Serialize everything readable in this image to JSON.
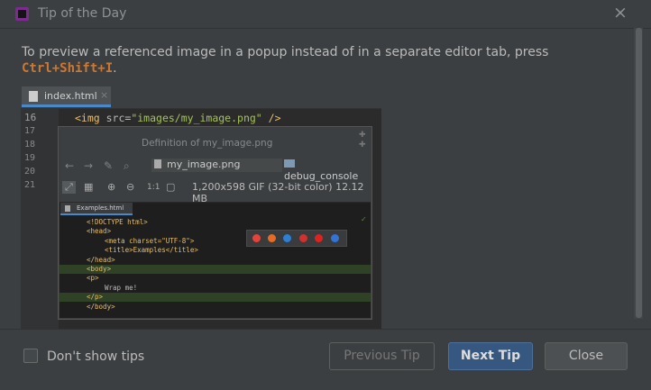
{
  "window": {
    "title": "Tip of the Day"
  },
  "tip": {
    "text": "To preview a referenced image in a popup instead of in a separate editor tab, press",
    "shortcut": "Ctrl+Shift+I",
    "trailing": "."
  },
  "editor": {
    "tab_label": "index.html",
    "line_numbers": [
      "16",
      "17",
      "18",
      "19",
      "20",
      "21"
    ],
    "code_open": "<img ",
    "code_attr": "src=",
    "code_value": "\"images/my_image.png\"",
    "code_close": " />"
  },
  "popup": {
    "title": "Definition of my_image.png",
    "file_name": "my_image.png",
    "folder_name": "debug_console",
    "zoom_actual": "1:1",
    "image_info": "1,200x598 GIF (32-bit color) 12.12 MB"
  },
  "preview": {
    "tab_label": "Examples.html",
    "lines": [
      {
        "text": "<!DOCTYPE html>",
        "indent": 0,
        "hl": false
      },
      {
        "text": "<head>",
        "indent": 0,
        "hl": false
      },
      {
        "text": "<meta charset=\"UTF-8\">",
        "indent": 2,
        "hl": false
      },
      {
        "text": "<title>Examples</title>",
        "indent": 2,
        "hl": false
      },
      {
        "text": "</head>",
        "indent": 0,
        "hl": false
      },
      {
        "text": "<body>",
        "indent": 0,
        "hl": true
      },
      {
        "text": "<p>",
        "indent": 0,
        "hl": false
      },
      {
        "text": "Wrap me!",
        "indent": 2,
        "hl": false
      },
      {
        "text": "</p>",
        "indent": 0,
        "hl": true
      },
      {
        "text": "</body>",
        "indent": 0,
        "hl": false
      }
    ],
    "browser_colors": [
      "#e5433a",
      "#e86a24",
      "#2d7fd3",
      "#d0312d",
      "#e0221f",
      "#3273d8"
    ]
  },
  "footer": {
    "dont_show_label": "Don't show tips",
    "dont_show_checked": false,
    "prev_label": "Previous Tip",
    "next_label": "Next Tip",
    "close_label": "Close"
  }
}
